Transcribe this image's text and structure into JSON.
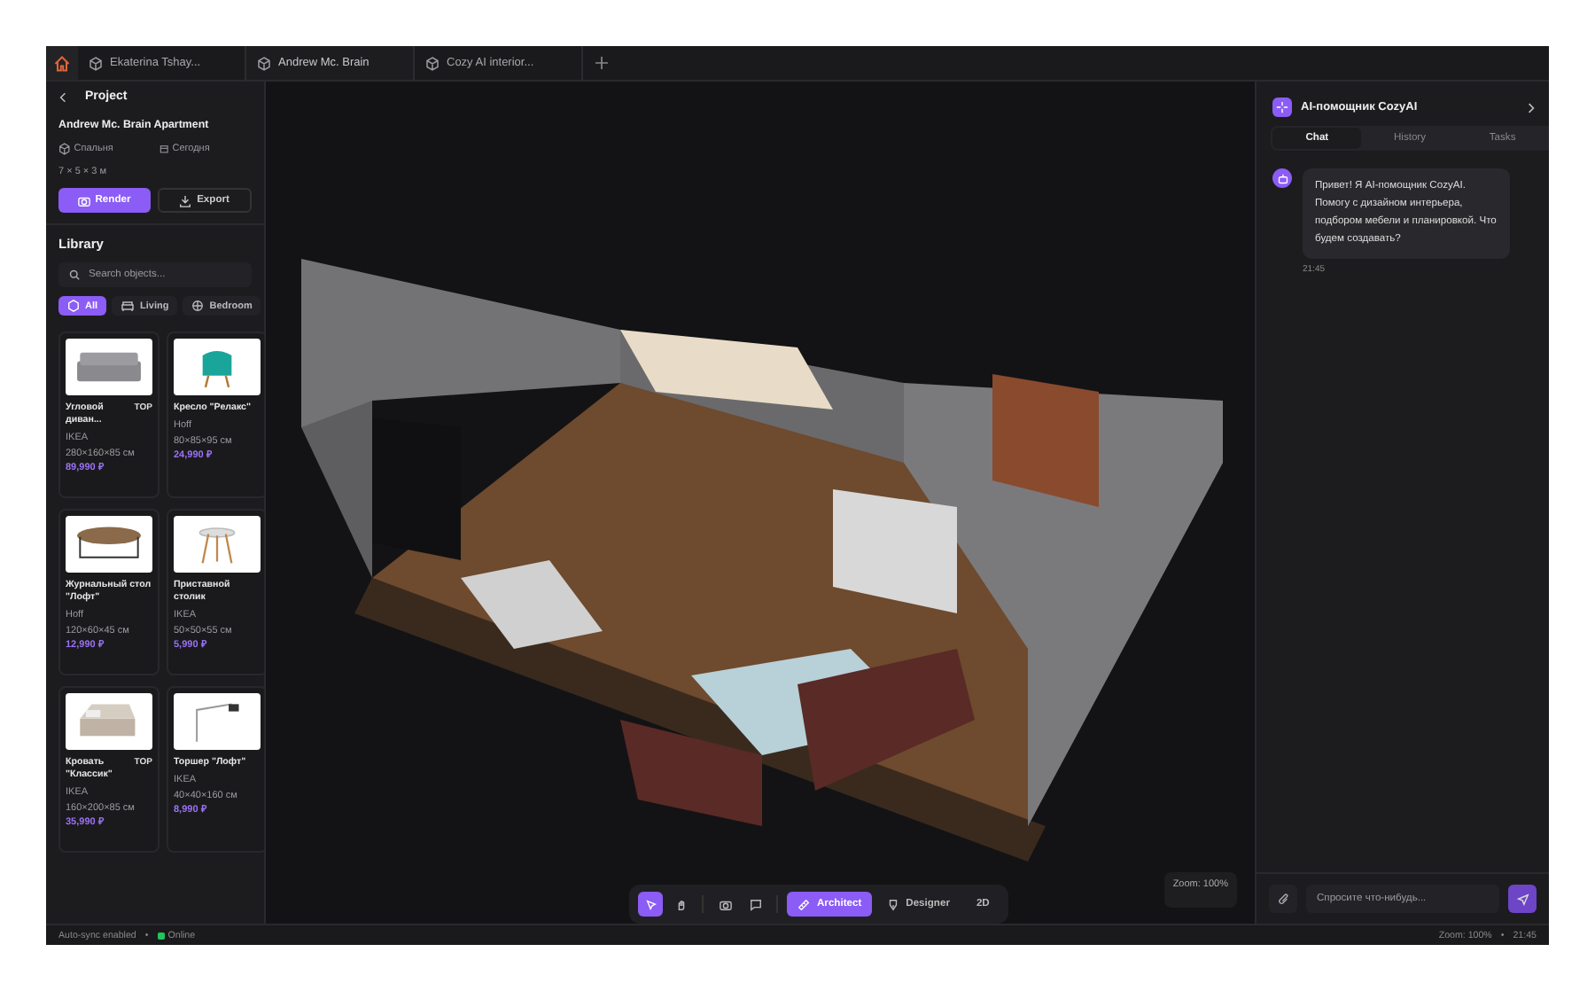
{
  "tabs": [
    {
      "label": "Ekaterina Tshay...",
      "selected": false
    },
    {
      "label": "Andrew Mc. Brain",
      "selected": true
    },
    {
      "label": "Cozy AI interior...",
      "selected": false
    }
  ],
  "project": {
    "title": "Project",
    "name": "Andrew Mc. Brain Apartment",
    "room": "Спальня",
    "date": "Сегодня",
    "dimensions": "7 × 5 × 3 м",
    "buttons": [
      {
        "label": "Render",
        "kind": "primary"
      },
      {
        "label": "Export",
        "kind": "secondary"
      }
    ]
  },
  "library": {
    "title": "Library",
    "search": {
      "placeholder": "Search objects..."
    },
    "filters": [
      {
        "label": "All",
        "selected": true
      },
      {
        "label": "Living",
        "selected": false
      },
      {
        "label": "Bedroom",
        "selected": false
      }
    ],
    "items": [
      {
        "name": "Угловой диван...",
        "badge": "TOP",
        "brand": "IKEA",
        "size": "280×160×85 см",
        "price": "89,990 ₽",
        "kind": "sofa"
      },
      {
        "name": "Кресло \"Релакс\"",
        "brand": "Hoff",
        "size": "80×85×95 см",
        "price": "24,990 ₽",
        "kind": "chair"
      },
      {
        "name": "Журнальный стол \"Лофт\"",
        "brand": "Hoff",
        "size": "120×60×45 см",
        "price": "12,990 ₽",
        "kind": "table"
      },
      {
        "name": "Приставной столик",
        "brand": "IKEA",
        "size": "50×50×55 см",
        "price": "5,990 ₽",
        "kind": "side-table"
      },
      {
        "name": "Кровать \"Классик\"",
        "badge": "TOP",
        "brand": "IKEA",
        "size": "160×200×85 см",
        "price": "35,990 ₽",
        "kind": "bed"
      },
      {
        "name": "Торшер \"Лофт\"",
        "brand": "IKEA",
        "size": "40×40×160 см",
        "price": "8,990 ₽",
        "kind": "lamp"
      }
    ]
  },
  "toolbar": {
    "tools": [
      {
        "kind": "select",
        "selected": true
      },
      {
        "kind": "pan",
        "selected": false
      },
      {
        "kind": "camera",
        "selected": false
      },
      {
        "kind": "comment",
        "selected": false
      }
    ],
    "modes": [
      {
        "label": "Architect",
        "kind": "ruler",
        "selected": true
      },
      {
        "label": "Designer",
        "kind": "pen",
        "selected": false
      },
      {
        "label": "2D",
        "kind": "plain",
        "selected": false
      }
    ]
  },
  "viewport": {
    "zoom": "Zoom: 100%"
  },
  "assistant": {
    "title": "AI-помощник CozyAI",
    "tabs": [
      {
        "label": "Chat",
        "selected": true
      },
      {
        "label": "History",
        "selected": false
      },
      {
        "label": "Tasks",
        "selected": false
      }
    ],
    "message": {
      "text": "Привет! Я AI-помощник CozyAI. Помогу с дизайном интерьера, подбором мебели и планировкой. Что будем создавать?",
      "time": "21:45"
    },
    "input": {
      "placeholder": "Спросите что-нибудь..."
    }
  },
  "status_bar": {
    "sync": "Auto-sync enabled",
    "separator_left": "•",
    "connection": "Online",
    "zoom": "Zoom: 100%",
    "separator_right": "•",
    "time": "21:45"
  }
}
